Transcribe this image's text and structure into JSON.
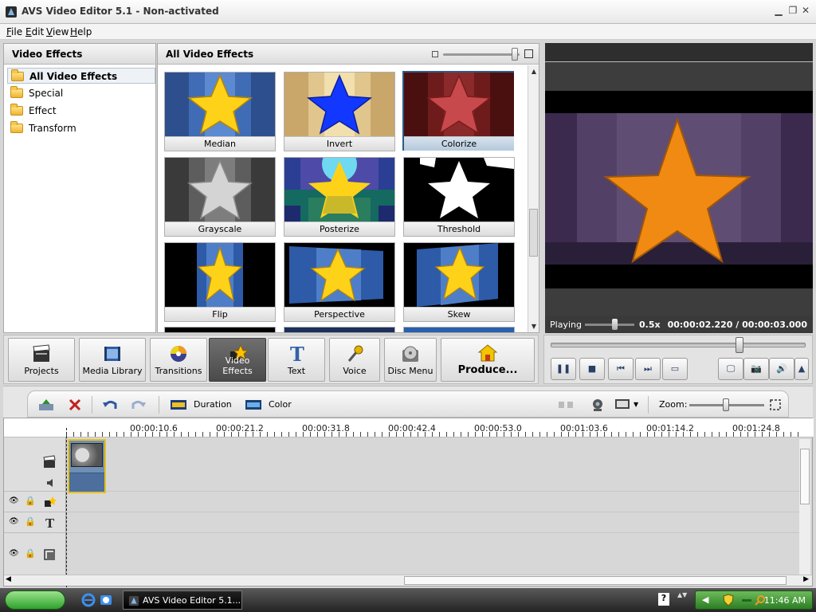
{
  "window": {
    "title": "AVS Video Editor 5.1 - Non-activated",
    "controls": [
      "minimize",
      "restore",
      "close"
    ]
  },
  "menu": [
    "File",
    "Edit",
    "View",
    "Help"
  ],
  "left_panel": {
    "header": "Video Effects",
    "items": [
      {
        "label": "All Video Effects",
        "selected": true
      },
      {
        "label": "Special",
        "selected": false
      },
      {
        "label": "Effect",
        "selected": false
      },
      {
        "label": "Transform",
        "selected": false
      }
    ]
  },
  "effects_panel": {
    "header": "All Video Effects",
    "tiles": [
      {
        "label": "Median",
        "icon": "median-star-icon",
        "selected": false
      },
      {
        "label": "Invert",
        "icon": "invert-star-icon",
        "selected": false
      },
      {
        "label": "Colorize",
        "icon": "colorize-star-icon",
        "selected": true
      },
      {
        "label": "Grayscale",
        "icon": "grayscale-star-icon",
        "selected": false
      },
      {
        "label": "Posterize",
        "icon": "posterize-star-icon",
        "selected": false
      },
      {
        "label": "Threshold",
        "icon": "threshold-star-icon",
        "selected": false
      },
      {
        "label": "Flip",
        "icon": "flip-star-icon",
        "selected": false
      },
      {
        "label": "Perspective",
        "icon": "perspective-star-icon",
        "selected": false
      },
      {
        "label": "Skew",
        "icon": "skew-star-icon",
        "selected": false
      }
    ]
  },
  "preview": {
    "status": "Playing",
    "speed": "0.5x",
    "timecode": "00:00:02.220 / 00:00:03.000",
    "accent_star": "#f08a12"
  },
  "tabs": [
    {
      "label": "Projects",
      "icon": "clapperboard-icon",
      "active": false
    },
    {
      "label": "Media Library",
      "icon": "film-library-icon",
      "active": false
    },
    {
      "label": "Transitions",
      "icon": "transitions-icon",
      "active": false
    },
    {
      "label": "Video Effects",
      "icon": "effects-star-icon",
      "active": true
    },
    {
      "label": "Text",
      "icon": "text-t-icon",
      "active": false
    },
    {
      "label": "Voice",
      "icon": "microphone-icon",
      "active": false
    },
    {
      "label": "Disc Menu",
      "icon": "disc-menu-icon",
      "active": false
    },
    {
      "label": "Produce...",
      "icon": "produce-house-icon",
      "active": false
    }
  ],
  "player_controls": [
    "pause",
    "stop",
    "previous",
    "next",
    "fullscreen",
    "monitor",
    "snapshot",
    "volume",
    "more"
  ],
  "timeline_toolbar": {
    "duration_label": "Duration",
    "color_label": "Color",
    "zoom_label": "Zoom:"
  },
  "timeline": {
    "ruler_labels": [
      "00:00:10.6",
      "00:00:21.2",
      "00:00:31.8",
      "00:00:42.4",
      "00:00:53.0",
      "00:01:03.6",
      "00:01:14.2",
      "00:01:24.8"
    ]
  },
  "taskbar": {
    "task_label": "AVS Video Editor 5.1...",
    "clock": "11:46 AM"
  }
}
